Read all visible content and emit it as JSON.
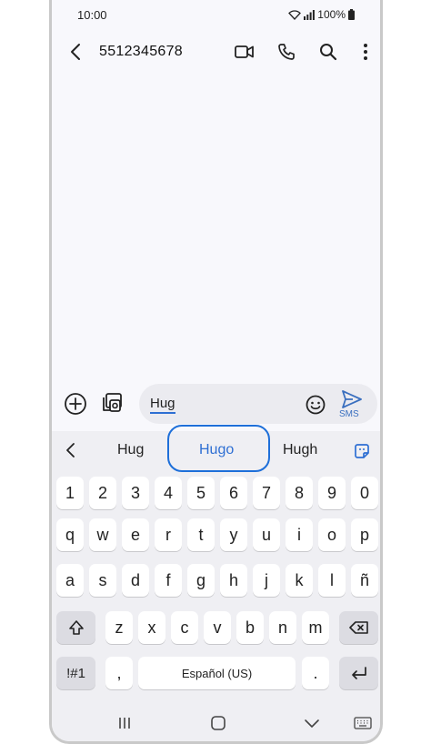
{
  "status": {
    "time": "10:00",
    "battery": "100%"
  },
  "appbar": {
    "contact": "5512345678"
  },
  "compose": {
    "text": "Hug",
    "send_label": "SMS"
  },
  "suggestions": [
    "Hug",
    "Hugo",
    "Hugh"
  ],
  "keyboard": {
    "numbers": [
      "1",
      "2",
      "3",
      "4",
      "5",
      "6",
      "7",
      "8",
      "9",
      "0"
    ],
    "row1": [
      "q",
      "w",
      "e",
      "r",
      "t",
      "y",
      "u",
      "i",
      "o",
      "p"
    ],
    "row2": [
      "a",
      "s",
      "d",
      "f",
      "g",
      "h",
      "j",
      "k",
      "l",
      "ñ"
    ],
    "row3": [
      "z",
      "x",
      "c",
      "v",
      "b",
      "n",
      "m"
    ],
    "symbols_label": "!#1",
    "comma": ",",
    "space_label": "Español (US)",
    "period": "."
  },
  "colors": {
    "accent": "#2e6fd3",
    "highlight_ring": "#1e6fd9"
  }
}
